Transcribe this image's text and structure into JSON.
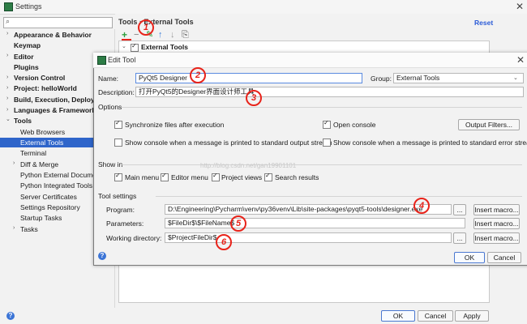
{
  "settings": {
    "title": "Settings",
    "search_placeholder": "",
    "sidebar": [
      {
        "label": "Appearance & Behavior",
        "bold": true,
        "arrow": "›"
      },
      {
        "label": "Keymap",
        "bold": true,
        "arrow": ""
      },
      {
        "label": "Editor",
        "bold": true,
        "arrow": "›"
      },
      {
        "label": "Plugins",
        "bold": true,
        "arrow": ""
      },
      {
        "label": "Version Control",
        "bold": true,
        "arrow": "›"
      },
      {
        "label": "Project: helloWorld",
        "bold": true,
        "arrow": "›"
      },
      {
        "label": "Build, Execution, Deployme",
        "bold": true,
        "arrow": "›"
      },
      {
        "label": "Languages & Frameworks",
        "bold": true,
        "arrow": "›"
      },
      {
        "label": "Tools",
        "bold": true,
        "arrow": "⌄"
      },
      {
        "label": "Web Browsers",
        "bold": false,
        "arrow": ""
      },
      {
        "label": "External Tools",
        "bold": false,
        "arrow": "",
        "selected": true
      },
      {
        "label": "Terminal",
        "bold": false,
        "arrow": ""
      },
      {
        "label": "Diff & Merge",
        "bold": false,
        "arrow": "›"
      },
      {
        "label": "Python External Document",
        "bold": false,
        "arrow": ""
      },
      {
        "label": "Python Integrated Tools",
        "bold": false,
        "arrow": ""
      },
      {
        "label": "Server Certificates",
        "bold": false,
        "arrow": ""
      },
      {
        "label": "Settings Repository",
        "bold": false,
        "arrow": ""
      },
      {
        "label": "Startup Tasks",
        "bold": false,
        "arrow": ""
      },
      {
        "label": "Tasks",
        "bold": false,
        "arrow": "›"
      }
    ],
    "breadcrumb": "Tools › External Tools",
    "reset_label": "Reset",
    "tools_group": "External Tools",
    "ok_label": "OK",
    "cancel_label": "Cancel",
    "apply_label": "Apply"
  },
  "edit_tool": {
    "title": "Edit Tool",
    "name_label": "Name:",
    "name_value": "PyQt5 Designer",
    "group_label": "Group:",
    "group_value": "External Tools",
    "description_label": "Description:",
    "description_value": "打开PyQt5的Designer界面设计师工具",
    "options_header": "Options",
    "sync_label": "Synchronize files after execution",
    "open_console_label": "Open console",
    "output_filters_label": "Output Filters...",
    "show_console_stdout_label": "Show console when a message is printed to standard output stream",
    "show_console_stderr_label": "Show console when a message is printed to standard error stream",
    "show_in_header": "Show in",
    "main_menu_label": "Main menu",
    "editor_menu_label": "Editor menu",
    "project_views_label": "Project views",
    "search_results_label": "Search results",
    "tool_settings_header": "Tool settings",
    "program_label": "Program:",
    "program_value": "D:\\Engineering\\Pycharm\\venv\\py36venv\\Lib\\site-packages\\pyqt5-tools\\designer.exe",
    "parameters_label": "Parameters:",
    "parameters_value": "$FileDir$\\$FileName$",
    "working_dir_label": "Working directory:",
    "working_dir_value": "$ProjectFileDir$",
    "browse_label": "...",
    "insert_macro_label": "Insert macro...",
    "ok_label": "OK",
    "cancel_label": "Cancel"
  },
  "annotations": [
    "1",
    "2",
    "3",
    "4",
    "5",
    "6"
  ],
  "watermark": "http://blog.csdn.net/gan19901101",
  "icons": {
    "add": "plus-icon",
    "remove": "minus-icon",
    "edit": "pencil-icon",
    "up": "arrow-up-icon",
    "down": "arrow-down-icon",
    "copy": "copy-icon",
    "help": "help-icon",
    "close": "close-icon"
  },
  "colors": {
    "accent": "#2f65ca",
    "annotation": "#e8231a",
    "add_green": "#2e9e3e"
  }
}
